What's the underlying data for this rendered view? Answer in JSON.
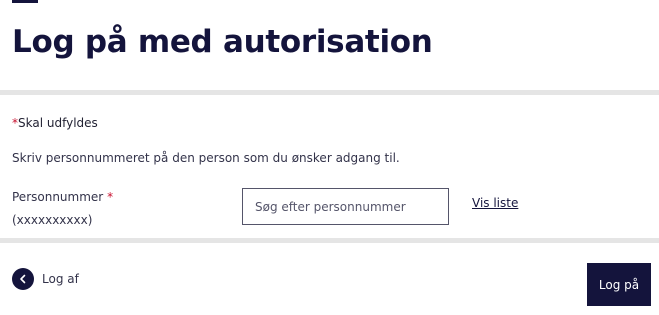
{
  "page": {
    "title": "Log på med autorisation"
  },
  "form": {
    "required_star": "*",
    "required_text": "Skal udfyldes",
    "instruction": "Skriv personnummeret på den person som du ønsker adgang til.",
    "field_label": "Personnummer",
    "field_star": "*",
    "field_format": "(xxxxxxxxxx)",
    "search_placeholder": "Søg efter personnummer",
    "search_value": "",
    "vis_liste": "Vis liste"
  },
  "footer": {
    "logout_label": "Log af",
    "login_button": "Log på"
  },
  "colors": {
    "brand": "#14143c",
    "required": "#c8102e",
    "divider": "#e5e5e5"
  },
  "icons": {
    "back": "chevron-left-icon"
  }
}
